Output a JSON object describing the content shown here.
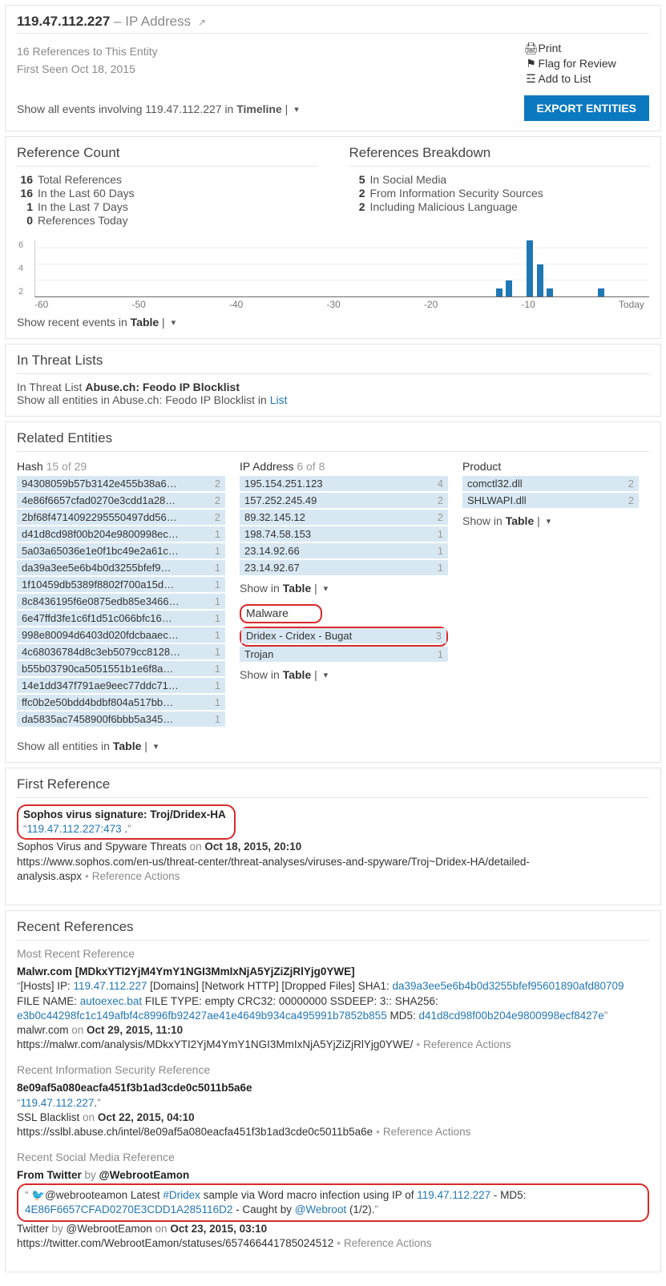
{
  "header": {
    "ip": "119.47.112.227",
    "type_label": "IP Address",
    "refs_line": "16 References to This Entity",
    "first_seen_line": "First Seen Oct 18, 2015",
    "timeline_prefix": "Show all events involving 119.47.112.227 in ",
    "timeline_mode": "Timeline",
    "actions": {
      "print": "Print",
      "flag": "Flag for Review",
      "add": "Add to List"
    },
    "export_btn": "EXPORT ENTITIES"
  },
  "ref_count": {
    "title": "Reference Count",
    "lines": [
      {
        "n": "16",
        "t": "Total References"
      },
      {
        "n": "16",
        "t": "In the Last 60 Days"
      },
      {
        "n": "1",
        "t": "In the Last 7 Days"
      },
      {
        "n": "0",
        "t": "References Today"
      }
    ],
    "breakdown_title": "References Breakdown",
    "breakdown_lines": [
      {
        "n": "5",
        "t": "In Social Media"
      },
      {
        "n": "2",
        "t": "From Information Security Sources"
      },
      {
        "n": "2",
        "t": "Including Malicious Language"
      }
    ],
    "show_recent": "Show recent events in ",
    "show_recent_mode": "Table"
  },
  "chart_data": {
    "type": "bar",
    "title": "",
    "xlabel": "",
    "ylabel": "",
    "xlim": [
      -60,
      0
    ],
    "categories": [
      -60,
      -50,
      -40,
      -30,
      -20,
      -10,
      "Today"
    ],
    "ylim": [
      0,
      7
    ],
    "yticks": [
      2,
      4,
      6
    ],
    "bars": [
      {
        "x": -15,
        "v": 1
      },
      {
        "x": -14,
        "v": 2
      },
      {
        "x": -12,
        "v": 7
      },
      {
        "x": -11,
        "v": 4
      },
      {
        "x": -10,
        "v": 1
      },
      {
        "x": -5,
        "v": 1
      }
    ]
  },
  "threat_lists": {
    "title": "In Threat Lists",
    "line_prefix": "In Threat List ",
    "list_name": "Abuse.ch: Feodo IP Blocklist",
    "show_prefix": "Show all entities in Abuse.ch: Feodo IP Blocklist in ",
    "show_mode": "List"
  },
  "related": {
    "title": "Related Entities",
    "hash_head": "Hash",
    "hash_cnt": "15 of 29",
    "ip_head": "IP Address",
    "ip_cnt": "6 of 8",
    "product_head": "Product",
    "malware_head": "Malware",
    "show_in": "Show in ",
    "show_mode": "Table",
    "show_all": "Show all entities in ",
    "hash": [
      {
        "v": "94308059b57b3142e455b38a6…",
        "c": "2"
      },
      {
        "v": "4e86f6657cfad0270e3cdd1a28…",
        "c": "2"
      },
      {
        "v": "2bf68f4714092295550497dd56…",
        "c": "2"
      },
      {
        "v": "d41d8cd98f00b204e9800998ec…",
        "c": "1"
      },
      {
        "v": "5a03a65036e1e0f1bc49e2a61c…",
        "c": "1"
      },
      {
        "v": "da39a3ee5e6b4b0d3255bfef9…",
        "c": "1"
      },
      {
        "v": "1f10459db5389f8802f700a15d…",
        "c": "1"
      },
      {
        "v": "8c8436195f6e0875edb85e3466…",
        "c": "1"
      },
      {
        "v": "6e47ffd3fe1c6f1d51c066bfc16…",
        "c": "1"
      },
      {
        "v": "998e80094d6403d020fdcbaaec…",
        "c": "1"
      },
      {
        "v": "4c68036784d8c3eb5079cc8128…",
        "c": "1"
      },
      {
        "v": "b55b03790ca5051551b1e6f8a…",
        "c": "1"
      },
      {
        "v": "14e1dd347f791ae9eec77ddc71…",
        "c": "1"
      },
      {
        "v": "ffc0b2e50bdd4bdbf804a517bb…",
        "c": "1"
      },
      {
        "v": "da5835ac7458900f6bbb5a345…",
        "c": "1"
      }
    ],
    "ip": [
      {
        "v": "195.154.251.123",
        "c": "4"
      },
      {
        "v": "157.252.245.49",
        "c": "2"
      },
      {
        "v": "89.32.145.12",
        "c": "2"
      },
      {
        "v": "198.74.58.153",
        "c": "1"
      },
      {
        "v": "23.14.92.66",
        "c": "1"
      },
      {
        "v": "23.14.92.67",
        "c": "1"
      }
    ],
    "product": [
      {
        "v": "comctl32.dll",
        "c": "2"
      },
      {
        "v": "SHLWAPI.dll",
        "c": "2"
      }
    ],
    "malware": [
      {
        "v": "Dridex - Cridex - Bugat",
        "c": "3"
      },
      {
        "v": "Trojan",
        "c": "1"
      }
    ]
  },
  "first_ref": {
    "title": "First Reference",
    "headline": "Sophos virus signature: Troj/Dridex-HA",
    "quote": "119.47.112.227:473",
    "source": "Sophos Virus and Spyware Threats",
    "on": " on ",
    "date": "Oct 18, 2015, 20:10",
    "url": "https://www.sophos.com/en-us/threat-center/threat-analyses/viruses-and-spyware/Troj~Dridex-HA/detailed-analysis.aspx",
    "actions": "Reference Actions"
  },
  "recent": {
    "title": "Recent References",
    "most": {
      "head": "Most Recent Reference",
      "title": "Malwr.com [MDkxYTI2YjM4YmY1NGI3MmIxNjA5YjZiZjRlYjg0YWE]",
      "q_pre": "[Hosts] IP: ",
      "ip": "119.47.112.227",
      "q_mid": " [Domains] [Network HTTP] [Dropped Files] SHA1: ",
      "sha1": "da39a3ee5e6b4b0d3255bfef95601890afd80709",
      "q_file": " FILE NAME: ",
      "file": "autoexec.bat",
      "q_after": " FILE TYPE: empty CRC32: 00000000 SSDEEP: 3:: SHA256: ",
      "sha256": "e3b0c44298fc1c149afbf4c8996fb92427ae41e4649b934ca495991b7852b855",
      "q_md5": " MD5: ",
      "md5": "d41d8cd98f00b204e9800998ecf8427e",
      "src": "malwr.com",
      "date": "Oct 29, 2015, 11:10",
      "url": "https://malwr.com/analysis/MDkxYTI2YjM4YmY1NGI3MmIxNjA5YjZiZjRlYjg0YWE/",
      "actions": "Reference Actions"
    },
    "infosec": {
      "head": "Recent Information Security Reference",
      "title": "8e09af5a080eacfa451f3b1ad3cde0c5011b5a6e",
      "quote": "119.47.112.227",
      "src": "SSL Blacklist",
      "date": "Oct 22, 2015, 04:10",
      "url": "https://sslbl.abuse.ch/intel/8e09af5a080eacfa451f3b1ad3cde0c5011b5a6e",
      "actions": "Reference Actions"
    },
    "social": {
      "head": "Recent Social Media Reference",
      "title_pre": "From Twitter ",
      "title_by": "by ",
      "title_handle": "@WebrootEamon",
      "q1": "@webrooteamon Latest ",
      "hash": "#Dridex",
      "q2": " sample via Word macro infection using IP of ",
      "ip": "119.47.112.227",
      "q3": " - MD5: ",
      "md5": "4E86F6657CFAD0270E3CDD1A285116D2",
      "q4": " - Caught by ",
      "at": "@Webroot",
      "q5": " (1/2).",
      "src": "Twitter ",
      "by": "by ",
      "handle": "@WebrootEamon",
      "on": " on ",
      "date": "Oct 23, 2015, 03:10",
      "url": "https://twitter.com/WebrootEamon/statuses/657466441785024512",
      "actions": "Reference Actions"
    }
  }
}
